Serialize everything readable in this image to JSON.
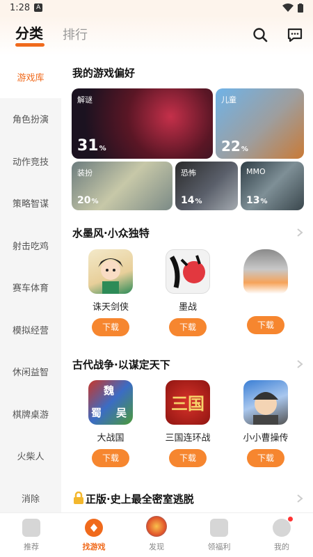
{
  "status_bar": {
    "time": "1:28",
    "app_badge": "A"
  },
  "header": {
    "tab_category": "分类",
    "tab_rank": "排行"
  },
  "sidebar": {
    "items": [
      {
        "label": "游戏库",
        "active": true
      },
      {
        "label": "角色扮演"
      },
      {
        "label": "动作竞技"
      },
      {
        "label": "策略智谋"
      },
      {
        "label": "射击吃鸡"
      },
      {
        "label": "赛车体育"
      },
      {
        "label": "模拟经营"
      },
      {
        "label": "休闲益智"
      },
      {
        "label": "棋牌桌游"
      },
      {
        "label": "火柴人"
      },
      {
        "label": "消除"
      }
    ]
  },
  "preferences": {
    "title": "我的游戏偏好",
    "tiles": [
      {
        "label": "解谜",
        "percent": "31",
        "unit": "%"
      },
      {
        "label": "儿童",
        "percent": "22",
        "unit": "%"
      },
      {
        "label": "装扮",
        "percent": "20",
        "unit": "%"
      },
      {
        "label": "恐怖",
        "percent": "14",
        "unit": "%"
      },
      {
        "label": "MMO",
        "percent": "13",
        "unit": "%"
      }
    ]
  },
  "sections": [
    {
      "title": "水墨风·小众独特",
      "games": [
        {
          "name": "诛天剑侠",
          "button": "下载"
        },
        {
          "name": "墨战",
          "button": "下载"
        },
        {
          "name": "",
          "button": "下载"
        }
      ]
    },
    {
      "title": "古代战争·以谋定天下",
      "games": [
        {
          "name": "大战国",
          "button": "下载",
          "icon_text": [
            "魏",
            "蜀",
            "吴"
          ]
        },
        {
          "name": "三国连环战",
          "button": "下载",
          "icon_text": "三国"
        },
        {
          "name": "小小曹操传",
          "button": "下载"
        }
      ]
    },
    {
      "title": "正版·史上最全密室逃脱"
    }
  ],
  "bottom_nav": [
    {
      "label": "推荐"
    },
    {
      "label": "找游戏",
      "active": true
    },
    {
      "label": "发现"
    },
    {
      "label": "领福利"
    },
    {
      "label": "我的"
    }
  ],
  "colors": {
    "accent": "#f06a1c",
    "button": "#f6862f"
  }
}
